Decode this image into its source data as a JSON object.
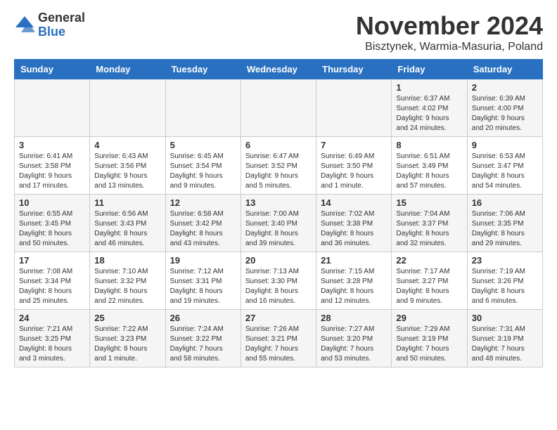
{
  "logo": {
    "general": "General",
    "blue": "Blue"
  },
  "title": "November 2024",
  "subtitle": "Bisztynek, Warmia-Masuria, Poland",
  "headers": [
    "Sunday",
    "Monday",
    "Tuesday",
    "Wednesday",
    "Thursday",
    "Friday",
    "Saturday"
  ],
  "weeks": [
    [
      {
        "day": "",
        "info": ""
      },
      {
        "day": "",
        "info": ""
      },
      {
        "day": "",
        "info": ""
      },
      {
        "day": "",
        "info": ""
      },
      {
        "day": "",
        "info": ""
      },
      {
        "day": "1",
        "info": "Sunrise: 6:37 AM\nSunset: 4:02 PM\nDaylight: 9 hours\nand 24 minutes."
      },
      {
        "day": "2",
        "info": "Sunrise: 6:39 AM\nSunset: 4:00 PM\nDaylight: 9 hours\nand 20 minutes."
      }
    ],
    [
      {
        "day": "3",
        "info": "Sunrise: 6:41 AM\nSunset: 3:58 PM\nDaylight: 9 hours\nand 17 minutes."
      },
      {
        "day": "4",
        "info": "Sunrise: 6:43 AM\nSunset: 3:56 PM\nDaylight: 9 hours\nand 13 minutes."
      },
      {
        "day": "5",
        "info": "Sunrise: 6:45 AM\nSunset: 3:54 PM\nDaylight: 9 hours\nand 9 minutes."
      },
      {
        "day": "6",
        "info": "Sunrise: 6:47 AM\nSunset: 3:52 PM\nDaylight: 9 hours\nand 5 minutes."
      },
      {
        "day": "7",
        "info": "Sunrise: 6:49 AM\nSunset: 3:50 PM\nDaylight: 9 hours\nand 1 minute."
      },
      {
        "day": "8",
        "info": "Sunrise: 6:51 AM\nSunset: 3:49 PM\nDaylight: 8 hours\nand 57 minutes."
      },
      {
        "day": "9",
        "info": "Sunrise: 6:53 AM\nSunset: 3:47 PM\nDaylight: 8 hours\nand 54 minutes."
      }
    ],
    [
      {
        "day": "10",
        "info": "Sunrise: 6:55 AM\nSunset: 3:45 PM\nDaylight: 8 hours\nand 50 minutes."
      },
      {
        "day": "11",
        "info": "Sunrise: 6:56 AM\nSunset: 3:43 PM\nDaylight: 8 hours\nand 46 minutes."
      },
      {
        "day": "12",
        "info": "Sunrise: 6:58 AM\nSunset: 3:42 PM\nDaylight: 8 hours\nand 43 minutes."
      },
      {
        "day": "13",
        "info": "Sunrise: 7:00 AM\nSunset: 3:40 PM\nDaylight: 8 hours\nand 39 minutes."
      },
      {
        "day": "14",
        "info": "Sunrise: 7:02 AM\nSunset: 3:38 PM\nDaylight: 8 hours\nand 36 minutes."
      },
      {
        "day": "15",
        "info": "Sunrise: 7:04 AM\nSunset: 3:37 PM\nDaylight: 8 hours\nand 32 minutes."
      },
      {
        "day": "16",
        "info": "Sunrise: 7:06 AM\nSunset: 3:35 PM\nDaylight: 8 hours\nand 29 minutes."
      }
    ],
    [
      {
        "day": "17",
        "info": "Sunrise: 7:08 AM\nSunset: 3:34 PM\nDaylight: 8 hours\nand 25 minutes."
      },
      {
        "day": "18",
        "info": "Sunrise: 7:10 AM\nSunset: 3:32 PM\nDaylight: 8 hours\nand 22 minutes."
      },
      {
        "day": "19",
        "info": "Sunrise: 7:12 AM\nSunset: 3:31 PM\nDaylight: 8 hours\nand 19 minutes."
      },
      {
        "day": "20",
        "info": "Sunrise: 7:13 AM\nSunset: 3:30 PM\nDaylight: 8 hours\nand 16 minutes."
      },
      {
        "day": "21",
        "info": "Sunrise: 7:15 AM\nSunset: 3:28 PM\nDaylight: 8 hours\nand 12 minutes."
      },
      {
        "day": "22",
        "info": "Sunrise: 7:17 AM\nSunset: 3:27 PM\nDaylight: 8 hours\nand 9 minutes."
      },
      {
        "day": "23",
        "info": "Sunrise: 7:19 AM\nSunset: 3:26 PM\nDaylight: 8 hours\nand 6 minutes."
      }
    ],
    [
      {
        "day": "24",
        "info": "Sunrise: 7:21 AM\nSunset: 3:25 PM\nDaylight: 8 hours\nand 3 minutes."
      },
      {
        "day": "25",
        "info": "Sunrise: 7:22 AM\nSunset: 3:23 PM\nDaylight: 8 hours\nand 1 minute."
      },
      {
        "day": "26",
        "info": "Sunrise: 7:24 AM\nSunset: 3:22 PM\nDaylight: 7 hours\nand 58 minutes."
      },
      {
        "day": "27",
        "info": "Sunrise: 7:26 AM\nSunset: 3:21 PM\nDaylight: 7 hours\nand 55 minutes."
      },
      {
        "day": "28",
        "info": "Sunrise: 7:27 AM\nSunset: 3:20 PM\nDaylight: 7 hours\nand 53 minutes."
      },
      {
        "day": "29",
        "info": "Sunrise: 7:29 AM\nSunset: 3:19 PM\nDaylight: 7 hours\nand 50 minutes."
      },
      {
        "day": "30",
        "info": "Sunrise: 7:31 AM\nSunset: 3:19 PM\nDaylight: 7 hours\nand 48 minutes."
      }
    ]
  ]
}
